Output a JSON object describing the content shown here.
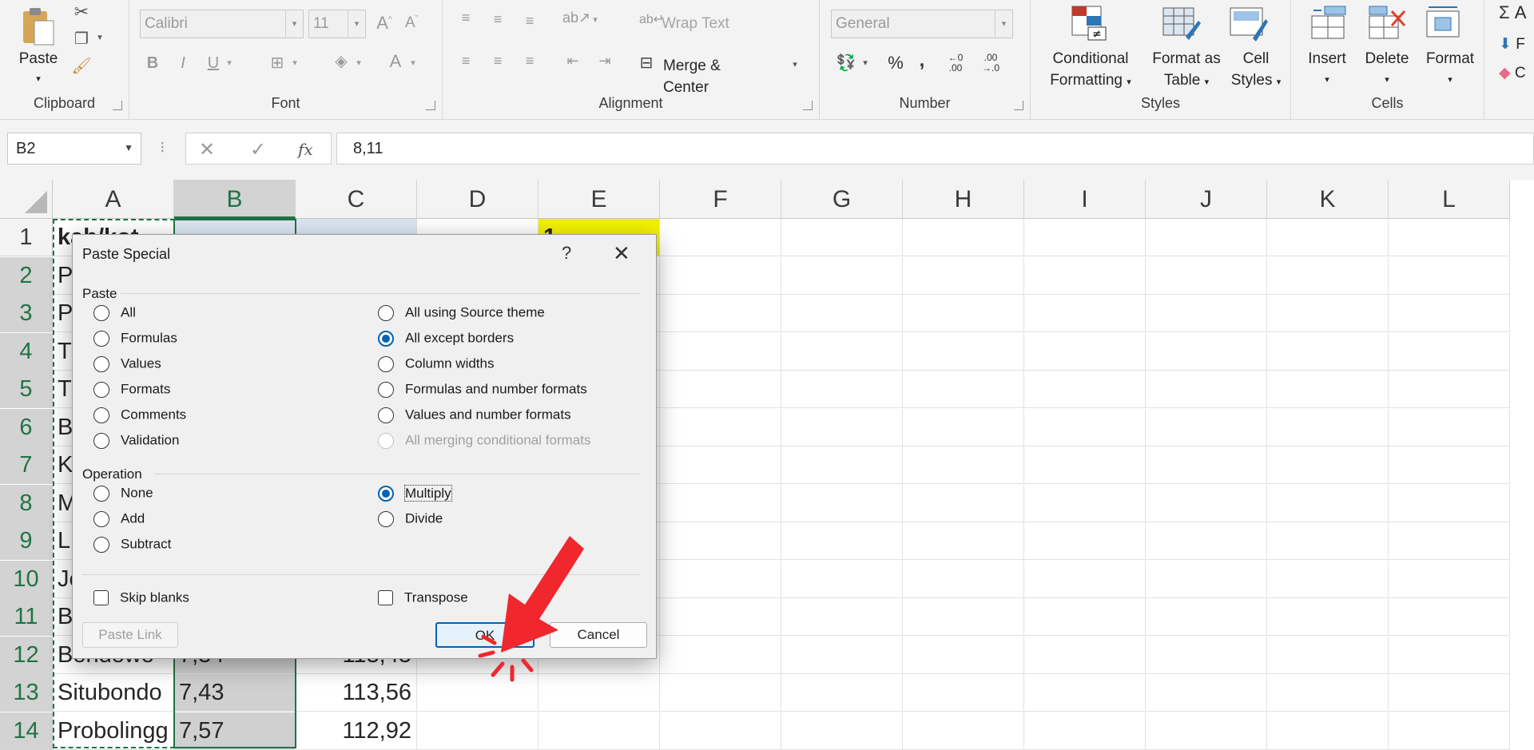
{
  "ribbon": {
    "clipboard": {
      "label": "Clipboard",
      "paste": "Paste"
    },
    "font": {
      "label": "Font",
      "font_name": "Calibri",
      "font_size": "11"
    },
    "alignment": {
      "label": "Alignment",
      "wrap_text": "Wrap Text",
      "merge_center": "Merge & Center"
    },
    "number": {
      "label": "Number",
      "format": "General",
      "percent": "%",
      "comma": ",",
      "inc_decimal_top": "←0",
      "inc_decimal_bottom": ".00",
      "dec_decimal_top": ".00",
      "dec_decimal_bottom": "→.0"
    },
    "styles": {
      "label": "Styles",
      "conditional_line1": "Conditional",
      "conditional_line2": "Formatting",
      "format_table_line1": "Format as",
      "format_table_line2": "Table",
      "cell_styles_line1": "Cell",
      "cell_styles_line2": "Styles"
    },
    "cells": {
      "label": "Cells",
      "insert": "Insert",
      "delete": "Delete",
      "format": "Format"
    },
    "editing": {
      "autosum": "A",
      "fill": "F",
      "clear": "C"
    }
  },
  "formula_bar": {
    "name_box": "B2",
    "fx": "fx",
    "cancel": "✕",
    "enter": "✓",
    "value": "8,11"
  },
  "columns": [
    "A",
    "B",
    "C",
    "D",
    "E",
    "F",
    "G",
    "H",
    "I",
    "J",
    "K",
    "L"
  ],
  "rows": [
    "1",
    "2",
    "3",
    "4",
    "5",
    "6",
    "7",
    "8",
    "9",
    "10",
    "11",
    "12",
    "13",
    "14"
  ],
  "cells": {
    "A1": "kab/kot",
    "E1": "1",
    "A2": "P",
    "A3": "P",
    "A4": "T",
    "A5": "T",
    "A6": "B",
    "A7": "K",
    "A8": "M",
    "A9": "L",
    "A10": "Je",
    "A11": "B",
    "A12": "Bondowo",
    "B12": "7,34",
    "C12": "113,45",
    "A13": "Situbondo",
    "B13": "7,43",
    "C13": "113,56",
    "A14": "Probolingg",
    "B14": "7,57",
    "C14": "112,92"
  },
  "dialog": {
    "title": "Paste Special",
    "help": "?",
    "close": "✕",
    "paste_section": "Paste",
    "paste_options_left": [
      "All",
      "Formulas",
      "Values",
      "Formats",
      "Comments",
      "Validation"
    ],
    "paste_options_right": [
      "All using Source theme",
      "All except borders",
      "Column widths",
      "Formulas and number formats",
      "Values and number formats",
      "All merging conditional formats"
    ],
    "paste_selected": "All except borders",
    "operation_section": "Operation",
    "operation_options_left": [
      "None",
      "Add",
      "Subtract"
    ],
    "operation_options_right": [
      "Multiply",
      "Divide"
    ],
    "operation_selected": "Multiply",
    "skip_blanks": "Skip blanks",
    "transpose": "Transpose",
    "paste_link": "Paste Link",
    "ok": "OK",
    "cancel": "Cancel"
  },
  "colors": {
    "accent": "#0063b1",
    "selection_green": "#217346",
    "highlight_yellow": "#f2f200",
    "pointer_red": "#f1272e"
  }
}
